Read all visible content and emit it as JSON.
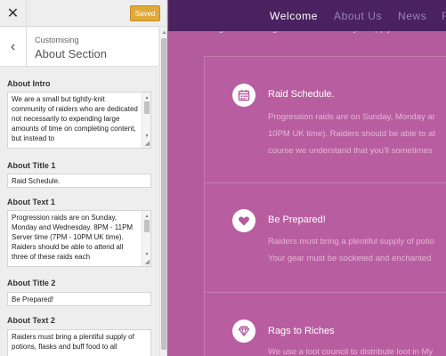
{
  "topbar": {
    "close_symbol": "✕",
    "save_label": "Saved"
  },
  "section": {
    "back_symbol": "‹",
    "breadcrumb": "Customising",
    "title": "About Section"
  },
  "controls": {
    "about_intro": {
      "label": "About Intro",
      "value": "We are a small but tightly-knit community of raiders who are dedicated not necessarily to expending large amounts of time on completing content, but instead to"
    },
    "about_title_1": {
      "label": "About Title 1",
      "value": "Raid Schedule."
    },
    "about_text_1": {
      "label": "About Text 1",
      "value": "Progression raids are on Sunday, Monday and Wednesday. 8PM - 11PM Server time (7PM - 10PM UK time). Raiders should be able to attend all three of these raids each"
    },
    "about_title_2": {
      "label": "About Title 2",
      "value": "Be Prepared!"
    },
    "about_text_2": {
      "label": "About Text 2",
      "value": "Raiders must bring a plentiful supply of potions, flasks and buff food to all"
    }
  },
  "preview": {
    "nav": {
      "welcome": "Welcome",
      "about": "About Us",
      "news": "News",
      "more": "F"
    },
    "intro_tail": "the guild. Please give it a read before you apply.",
    "features": [
      {
        "icon": "calendar-icon",
        "title": "Raid Schedule.",
        "lines": [
          "Progression raids are on Sunday, Monday ar",
          "10PM UK time). Raiders should be able to at",
          "course we understand that you'll sometimes"
        ]
      },
      {
        "icon": "heart-icon",
        "title": "Be Prepared!",
        "lines": [
          "Raiders must bring a plentiful supply of potio",
          "Your gear must be socketed and enchanted"
        ]
      },
      {
        "icon": "diamond-icon",
        "title": "Rags to Riches",
        "lines": [
          "We use a loot council to distribute loot in My"
        ]
      }
    ]
  },
  "colors": {
    "accent": "#b35a9c",
    "nav_bg": "#4a2260",
    "save": "#e0a93a"
  }
}
